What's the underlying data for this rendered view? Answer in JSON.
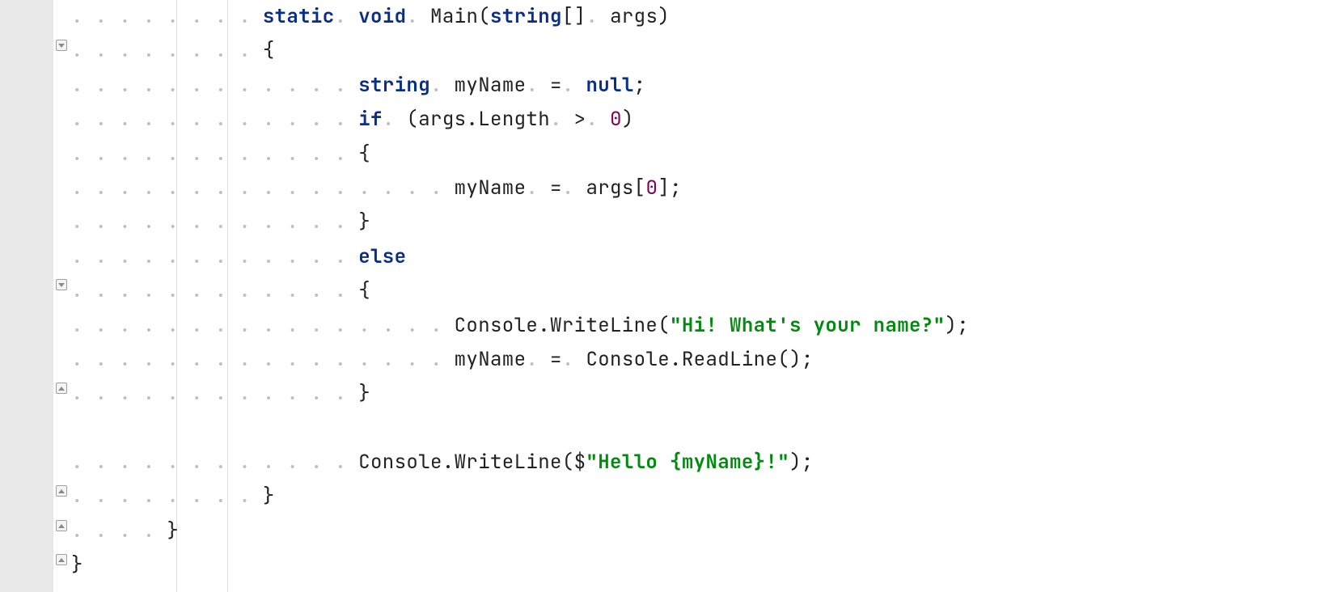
{
  "editor": {
    "lineHeight": 42.4,
    "indentDots4": ". . . . ",
    "indentDots3": ". . . ",
    "indentDots2": ". . ",
    "dot": ". ",
    "lines": {
      "l1": {
        "ws": ". . . . . . . . ",
        "k_static": "static",
        "sp1": " ",
        "k_void": "void",
        "sp2": " ",
        "m_main": "Main(",
        "k_string": "string",
        "arr": "[]",
        "sp3": " ",
        "args": "args)"
      },
      "l2": {
        "ws": ". . . . . . . . ",
        "brace": "{"
      },
      "l3": {
        "ws": ". . . . . . . . . . . . ",
        "k_string": "string",
        "sp1": " ",
        "var": "myName",
        "sp2": " ",
        "eq": "=",
        "sp3": " ",
        "k_null": "null",
        "semi": ";"
      },
      "l4": {
        "ws": ". . . . . . . . . . . . ",
        "k_if": "if",
        "sp1": " ",
        "open": "(args.Length",
        "sp2": " ",
        "gt": ">",
        "sp3": " ",
        "zero": "0",
        "close": ")"
      },
      "l5": {
        "ws": ". . . . . . . . . . . . ",
        "brace": "{"
      },
      "l6": {
        "ws": ". . . . . . . . . . . . . . . . ",
        "expr1": "myName",
        "sp1": " ",
        "eq": "=",
        "sp2": " ",
        "expr2": "args[",
        "zero": "0",
        "close": "];"
      },
      "l7": {
        "ws": ". . . . . . . . . . . . ",
        "brace": "}"
      },
      "l8": {
        "ws": ". . . . . . . . . . . . ",
        "k_else": "else"
      },
      "l9": {
        "ws": ". . . . . . . . . . . . ",
        "brace": "{"
      },
      "l10": {
        "ws": ". . . . . . . . . . . . . . . . ",
        "call": "Console.WriteLine(",
        "str": "\"Hi! What's your name?\"",
        "end": ");"
      },
      "l11": {
        "ws": ". . . . . . . . . . . . . . . . ",
        "expr1": "myName",
        "sp1": " ",
        "eq": "=",
        "sp2": " ",
        "call": "Console.ReadLine();"
      },
      "l12": {
        "ws": ". . . . . . . . . . . . ",
        "brace": "}"
      },
      "l13": {
        "ws": ""
      },
      "l14": {
        "ws": ". . . . . . . . . . . . ",
        "call": "Console.WriteLine($",
        "q1": "\"",
        "hello": "Hello ",
        "iopen": "{",
        "ivar": "myName",
        "iclose": "}",
        "bang": "!",
        "q2": "\"",
        "end": ");"
      },
      "l15": {
        "ws": ". . . . . . . . ",
        "brace": "}"
      },
      "l16": {
        "ws": ". . . . ",
        "brace": "}"
      },
      "l17": {
        "ws": "",
        "brace": "}"
      }
    },
    "folds": [
      {
        "row": 1,
        "kind": "minus"
      },
      {
        "row": 8,
        "kind": "minus"
      },
      {
        "row": 11,
        "kind": "up"
      },
      {
        "row": 14,
        "kind": "up"
      },
      {
        "row": 15,
        "kind": "up"
      },
      {
        "row": 16,
        "kind": "up"
      }
    ]
  }
}
